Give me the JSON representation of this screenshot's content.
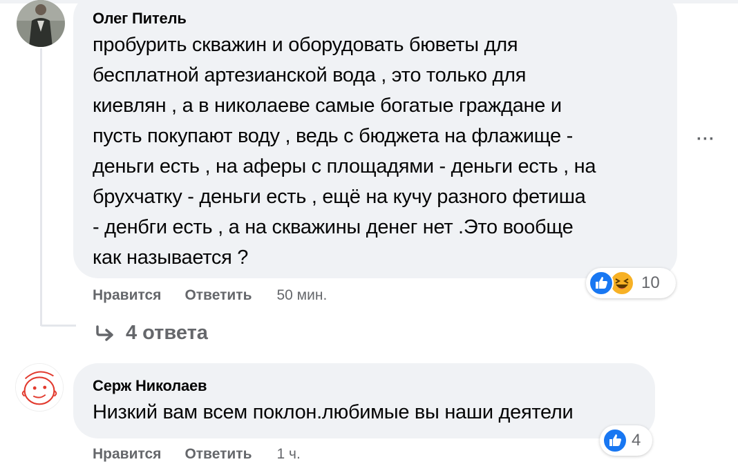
{
  "comments": [
    {
      "author": "Олег Питель",
      "lines": [
        "пробурить скважин и оборудовать бюветы для",
        "бесплатной артезианской вода , это только для",
        "киевлян , а в николаеве самые богатые граждане и",
        "пусть покупают воду , ведь с бюджета на флажище -",
        "деньги есть , на аферы с площадями - деньги есть , на",
        "брухчатку - деньги есть , ещё на кучу разного фетиша",
        "- денбги есть , а на скважины денег нет .Это вообще",
        "как называется ?"
      ],
      "like_label": "Нравится",
      "reply_label": "Ответить",
      "time": "50 мин.",
      "reactions": {
        "icons": [
          "like-icon",
          "haha-icon"
        ],
        "count": "10"
      },
      "more_label": "···",
      "replies_label": "4 ответа"
    },
    {
      "author": "Серж Николаев",
      "lines": [
        "Низкий вам всем поклон.любимые вы наши деятели"
      ],
      "like_label": "Нравится",
      "reply_label": "Ответить",
      "time": "1 ч.",
      "reactions": {
        "icons": [
          "like-icon"
        ],
        "count": "4"
      }
    }
  ],
  "colors": {
    "bubble": "#f0f2f5",
    "secondary_text": "#65676b",
    "like_blue": "#1877f2",
    "haha_yellow": "#f7b125"
  }
}
